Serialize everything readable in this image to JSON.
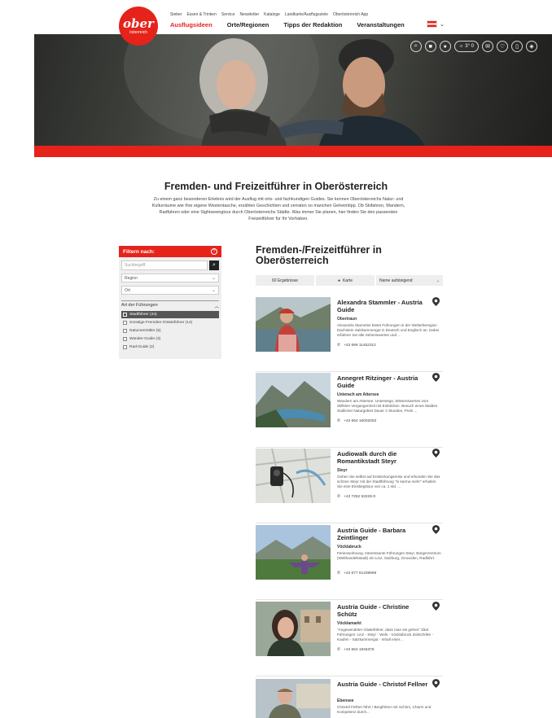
{
  "header": {
    "logo_main": "ober",
    "logo_sub": "österreich",
    "top_links": [
      "Sieber",
      "Essen & Trinken",
      "Service",
      "Newsletter",
      "Kataloge",
      "Landkarte/Ausflugsziele",
      "Oberösterreich App"
    ],
    "main_nav": [
      "Ausflugsideen",
      "Orte/Regionen",
      "Tipps der Redaktion",
      "Veranstaltungen"
    ],
    "language_chevron": "⌄"
  },
  "hero": {
    "weather_temp": "3° 0",
    "icons": [
      "search-icon",
      "camera-icon",
      "location-icon",
      "weather-icon",
      "mail-icon",
      "heart-icon",
      "mobile-icon",
      "compass-icon"
    ]
  },
  "intro": {
    "title": "Fremden- und Freizeitführer in Oberösterreich",
    "text": "Zu einem ganz besonderen Erlebnis wird der Ausflug mit orts- und fachkundigen Guides. Sie kennen Oberösterreichs Natur- und Kulturräume wie Ihre eigene Westentasche, erzählen Geschichten und verraten so manchen Geheimtipp. Ob Skifahren, Wandern, Radfahren oder eine Sightseeingtour durch Oberösterreichs Städte. Was immer Sie planen, hier finden Sie den passenden Freizeitführer für Ihr Vorhaben."
  },
  "filters": {
    "head_label": "Filtern nach:",
    "help": "?",
    "search_placeholder": "Suchbegriff",
    "region_select": "Region",
    "ort_select": "Ort",
    "category_label": "Art der Führungen",
    "options": [
      {
        "label": "Stadtführer (44)",
        "active": true
      },
      {
        "label": "Sonstige Fremden-/Gästeführer (14)",
        "active": false
      },
      {
        "label": "Naturvermittler (5)",
        "active": false
      },
      {
        "label": "Wander-Guide (3)",
        "active": false
      },
      {
        "label": "Rad-Guide (2)",
        "active": false
      }
    ]
  },
  "results": {
    "title": "Fremden-/Freizeitführer in Oberösterreich",
    "count_label": "60 Ergebnisse",
    "map_label": "Karte",
    "sort_label": "Name aufsteigend",
    "items": [
      {
        "title": "Alexandra Stammler - Austria Guide",
        "location": "Obertraun",
        "desc": "Alexandra Stammler bietet Führungen in der Welterberegion Dachstein Salzkammergut in Deutsch und Englisch an. Dabei erfahren Sie alle Sehenswerten und ...",
        "phone": "+43 699 11452312"
      },
      {
        "title": "Annegret Ritzinger - Austria Guide",
        "location": "Unterach am Attersee",
        "desc": "Wandern am Attersee. Unterwegs, Wissenswertes vom Stillsten Vergangenheit mit Einblicken. Besuch eines Waldes Südlicher Naturgebiet Dauer 2 Stunden, Preis ...",
        "phone": "+43 664 16002053"
      },
      {
        "title": "Audiowalk durch die Romantikstadt Steyr",
        "location": "Steyr",
        "desc": "Gehen Sie selbst auf Entdeckungsreise und erkunden Sie das schöne Steyr mit der Stadtführung \"in karma mehr\" erhalten Sie eine Einstiegstour von ca. 1 std. ...",
        "phone": "+43 7252 53229-0"
      },
      {
        "title": "Austria Guide - Barbara Zeintlinger",
        "location": "Vöcklabruck",
        "desc": "Ferienwohnung, Interessante Führungen Steyr, Bürgerzentrum (Welthandelsstadt) ein Linz, Salzburg, Gmunden, Radfahrt.",
        "phone": "+43 677 61339969"
      },
      {
        "title": "Austria Guide - Christine Schütz",
        "location": "Vöcklamarkt",
        "desc": "\"Angewendeter Gästeführer, dass man sie gehen\" Zitat Führungen: Linz - Steyr - Wels - Vöcklabruck Zeitschritte - Kaufen - Salzkammergut - Inhalt einer...",
        "phone": "+43 664 1845376"
      },
      {
        "title": "Austria Guide - Christof Fellner",
        "location": "Ebensee",
        "desc": "Christof Fellner führt / Bergführer mit Schirm, Charm und Kompetenz durch...",
        "phone": ""
      }
    ]
  }
}
